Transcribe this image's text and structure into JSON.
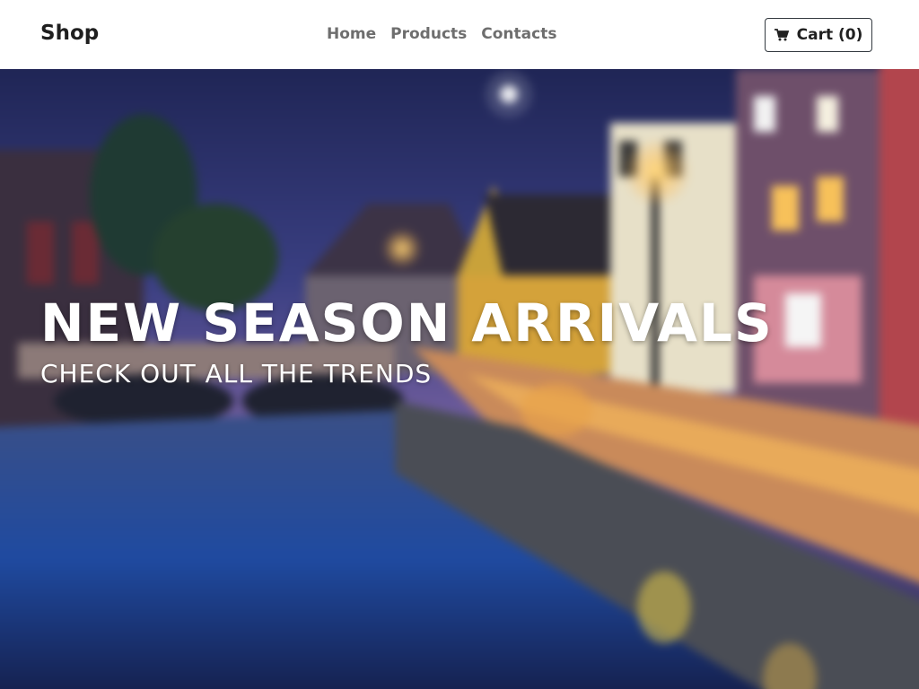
{
  "navbar": {
    "brand": "Shop",
    "links": [
      {
        "label": "Home"
      },
      {
        "label": "Products"
      },
      {
        "label": "Contacts"
      }
    ],
    "cart": {
      "label": "Cart (0)",
      "icon": "shopping-cart-icon"
    }
  },
  "hero": {
    "title": "NEW SEASON ARRIVALS",
    "subtitle": "CHECK OUT ALL THE TRENDS",
    "background": "night-canal-town-photo"
  },
  "colors": {
    "brand_text": "#1f1f1f",
    "nav_link": "#6e6e6e",
    "cart_border": "#343a40",
    "hero_text": "#ffffff"
  }
}
